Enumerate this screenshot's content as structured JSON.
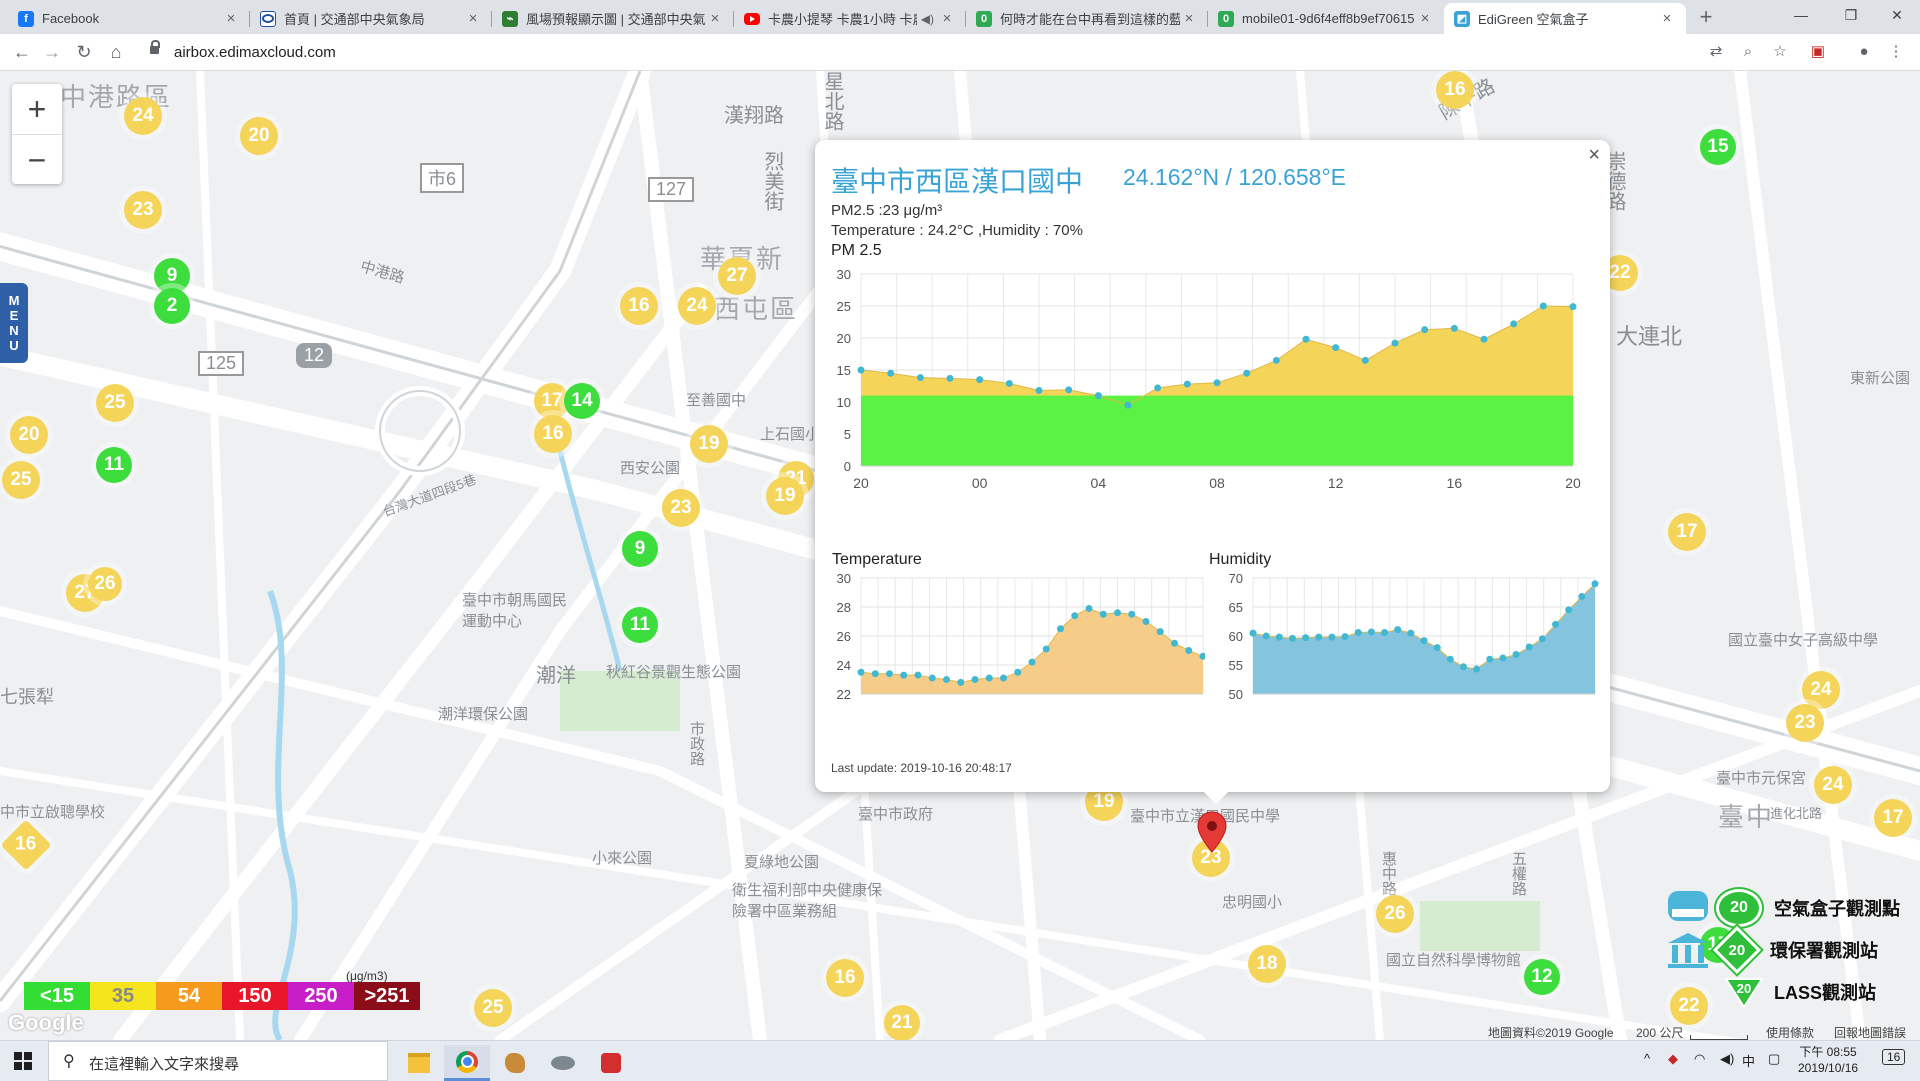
{
  "browser": {
    "tabs": [
      {
        "title": "Facebook",
        "favicon": "facebook-icon",
        "color": "#1877f2"
      },
      {
        "title": "首頁 | 交通部中央氣象局",
        "favicon": "cwb-icon",
        "color": "#2050a0"
      },
      {
        "title": "風場預報顯示圖 | 交通部中央氣象",
        "favicon": "map-icon",
        "color": "#2e7d32"
      },
      {
        "title": "卡農小提琴 卡農1小時 卡農",
        "favicon": "youtube-icon",
        "color": "#ff0000"
      },
      {
        "title": "何時才能在台中再看到這樣的藍",
        "favicon": "mobile01-icon",
        "color": "#2eaa55"
      },
      {
        "title": "mobile01-9d6f4eff8b9ef70615",
        "favicon": "mobile01-icon",
        "color": "#2eaa55"
      },
      {
        "title": "EdiGreen 空氣盒子",
        "favicon": "edigreen-icon",
        "color": "#3aa3d6"
      }
    ],
    "url": "airbox.edimaxcloud.com"
  },
  "map": {
    "labels": [
      "中港路區",
      "漢翔路",
      "星北路",
      "市6",
      "127",
      "烈美街",
      "華夏新",
      "西屯區",
      "125",
      "12",
      "西安公園",
      "至善國中",
      "上石國小",
      "台灣大道四段5巷",
      "臺中市朝馬國民運動中心",
      "潮洋",
      "潮洋環保公園",
      "秋紅谷景觀生態公園",
      "七張犁",
      "中市立啟聰學校",
      "小來公園",
      "夏綠地公園",
      "衛生福利部中央健康保險署中區業務組",
      "臺中市政府",
      "臺中市立漢口國民中學",
      "忠明國小",
      "國立自然科學博物館",
      "大連北",
      "東新公園",
      "國立臺中女子高級中學",
      "臺中市元保宮",
      "臺中",
      "進化北路",
      "陳平路",
      "市政路",
      "惠中路",
      "崇德路",
      "五權路",
      "中港路"
    ],
    "markers": [
      {
        "v": "24",
        "t": "y"
      },
      {
        "v": "20",
        "t": "y"
      },
      {
        "v": "23",
        "t": "y"
      },
      {
        "v": "9",
        "t": "g"
      },
      {
        "v": "2",
        "t": "g"
      },
      {
        "v": "25",
        "t": "y"
      },
      {
        "v": "20",
        "t": "y"
      },
      {
        "v": "11",
        "t": "g"
      },
      {
        "v": "25",
        "t": "y"
      },
      {
        "v": "27",
        "t": "y"
      },
      {
        "v": "16",
        "t": "y"
      },
      {
        "v": "24",
        "t": "y"
      },
      {
        "v": "27",
        "t": "y"
      },
      {
        "v": "17",
        "t": "y"
      },
      {
        "v": "14",
        "t": "g"
      },
      {
        "v": "16",
        "t": "y"
      },
      {
        "v": "19",
        "t": "y"
      },
      {
        "v": "21",
        "t": "y"
      },
      {
        "v": "19",
        "t": "y"
      },
      {
        "v": "23",
        "t": "y"
      },
      {
        "v": "9",
        "t": "g"
      },
      {
        "v": "11",
        "t": "g"
      },
      {
        "v": "16",
        "t": "d"
      },
      {
        "v": "16",
        "t": "y"
      },
      {
        "v": "15",
        "t": "g"
      },
      {
        "v": "22",
        "t": "y"
      },
      {
        "v": "17",
        "t": "y"
      },
      {
        "v": "24",
        "t": "y"
      },
      {
        "v": "23",
        "t": "y"
      },
      {
        "v": "24",
        "t": "y"
      },
      {
        "v": "17",
        "t": "y"
      },
      {
        "v": "19",
        "t": "y"
      },
      {
        "v": "23",
        "t": "y"
      },
      {
        "v": "26",
        "t": "y"
      },
      {
        "v": "18",
        "t": "y"
      },
      {
        "v": "12",
        "t": "g"
      },
      {
        "v": "16",
        "t": "y"
      },
      {
        "v": "21",
        "t": "y"
      },
      {
        "v": "25",
        "t": "y"
      },
      {
        "v": "22",
        "t": "y"
      },
      {
        "v": "17",
        "t": "g"
      },
      {
        "v": "26",
        "t": "y"
      }
    ],
    "zoom_in": "+",
    "zoom_out": "−",
    "menu": "MENU",
    "legend": [
      {
        "label": "<15",
        "color": "#33dd33"
      },
      {
        "label": "35",
        "color": "#f5e51c"
      },
      {
        "label": "54",
        "color": "#f59a1c"
      },
      {
        "label": "150",
        "color": "#e8162a"
      },
      {
        "label": "250",
        "color": "#c81ec8"
      },
      {
        "label": ">251",
        "color": "#8b0d1a"
      }
    ],
    "legend_unit": "(μg/m3)",
    "google": "Google",
    "map_types": [
      {
        "label": "空氣盒子觀測點",
        "value": "20"
      },
      {
        "label": "環保署觀測站",
        "value": "20"
      },
      {
        "label": "LASS觀測站",
        "value": "20"
      }
    ],
    "attribution": "地圖資料©2019 Google",
    "scale": "200 公尺",
    "terms": "使用條款",
    "report": "回報地圖錯誤"
  },
  "popup": {
    "title": "臺中市西區漢口國中",
    "coords": "24.162°N / 120.658°E",
    "pm25": "PM2.5 :23 μg/m³",
    "temp_hum": "Temperature : 24.2°C ,Humidity : 70%",
    "chart_title": "PM 2.5",
    "temp_title": "Temperature",
    "hum_title": "Humidity",
    "last_update": "Last update: 2019-10-16 20:48:17",
    "close": "×"
  },
  "chart_data": [
    {
      "type": "area",
      "title": "PM 2.5",
      "x_ticks": [
        "20",
        "00",
        "04",
        "08",
        "12",
        "16",
        "20"
      ],
      "ylim": [
        0,
        30
      ],
      "y_ticks": [
        0,
        5,
        10,
        15,
        20,
        25,
        30
      ],
      "threshold": 11,
      "colors": {
        "below": "#5cf244",
        "above": "#f5d45a",
        "point": "#41b8d3"
      },
      "values": [
        15,
        14.5,
        13.8,
        13.7,
        13.5,
        12.9,
        11.8,
        11.9,
        11,
        9.5,
        12.2,
        12.8,
        13,
        14.5,
        16.5,
        19.8,
        18.5,
        16.5,
        19.2,
        21.3,
        21.5,
        19.8,
        22.2,
        25,
        24.9
      ]
    },
    {
      "type": "area",
      "title": "Temperature",
      "ylim": [
        22,
        30
      ],
      "y_ticks": [
        22,
        24,
        26,
        28,
        30
      ],
      "colors": {
        "fill": "#f6c983",
        "point": "#41b8d3"
      },
      "values": [
        23.5,
        23.4,
        23.4,
        23.3,
        23.3,
        23.1,
        23.0,
        22.8,
        23.0,
        23.1,
        23.1,
        23.5,
        24.2,
        25.1,
        26.5,
        27.4,
        27.9,
        27.5,
        27.6,
        27.5,
        27.0,
        26.3,
        25.5,
        25.0,
        24.6
      ]
    },
    {
      "type": "area",
      "title": "Humidity",
      "ylim": [
        50,
        70
      ],
      "y_ticks": [
        50,
        55,
        60,
        65,
        70
      ],
      "colors": {
        "fill": "#7ec1dd",
        "point": "#41b8d3"
      },
      "values": [
        60.5,
        60,
        59.8,
        59.6,
        59.7,
        59.8,
        59.8,
        59.9,
        60.6,
        60.7,
        60.6,
        61.1,
        60.5,
        59.2,
        58.0,
        56.0,
        54.7,
        54.3,
        56,
        56.2,
        56.8,
        58.1,
        59.5,
        62,
        64.5,
        66.8,
        69
      ]
    }
  ],
  "taskbar": {
    "search_placeholder": "在這裡輸入文字來搜尋",
    "time": "下午 08:55",
    "date": "2019/10/16",
    "ime": "中",
    "notif": "16"
  }
}
